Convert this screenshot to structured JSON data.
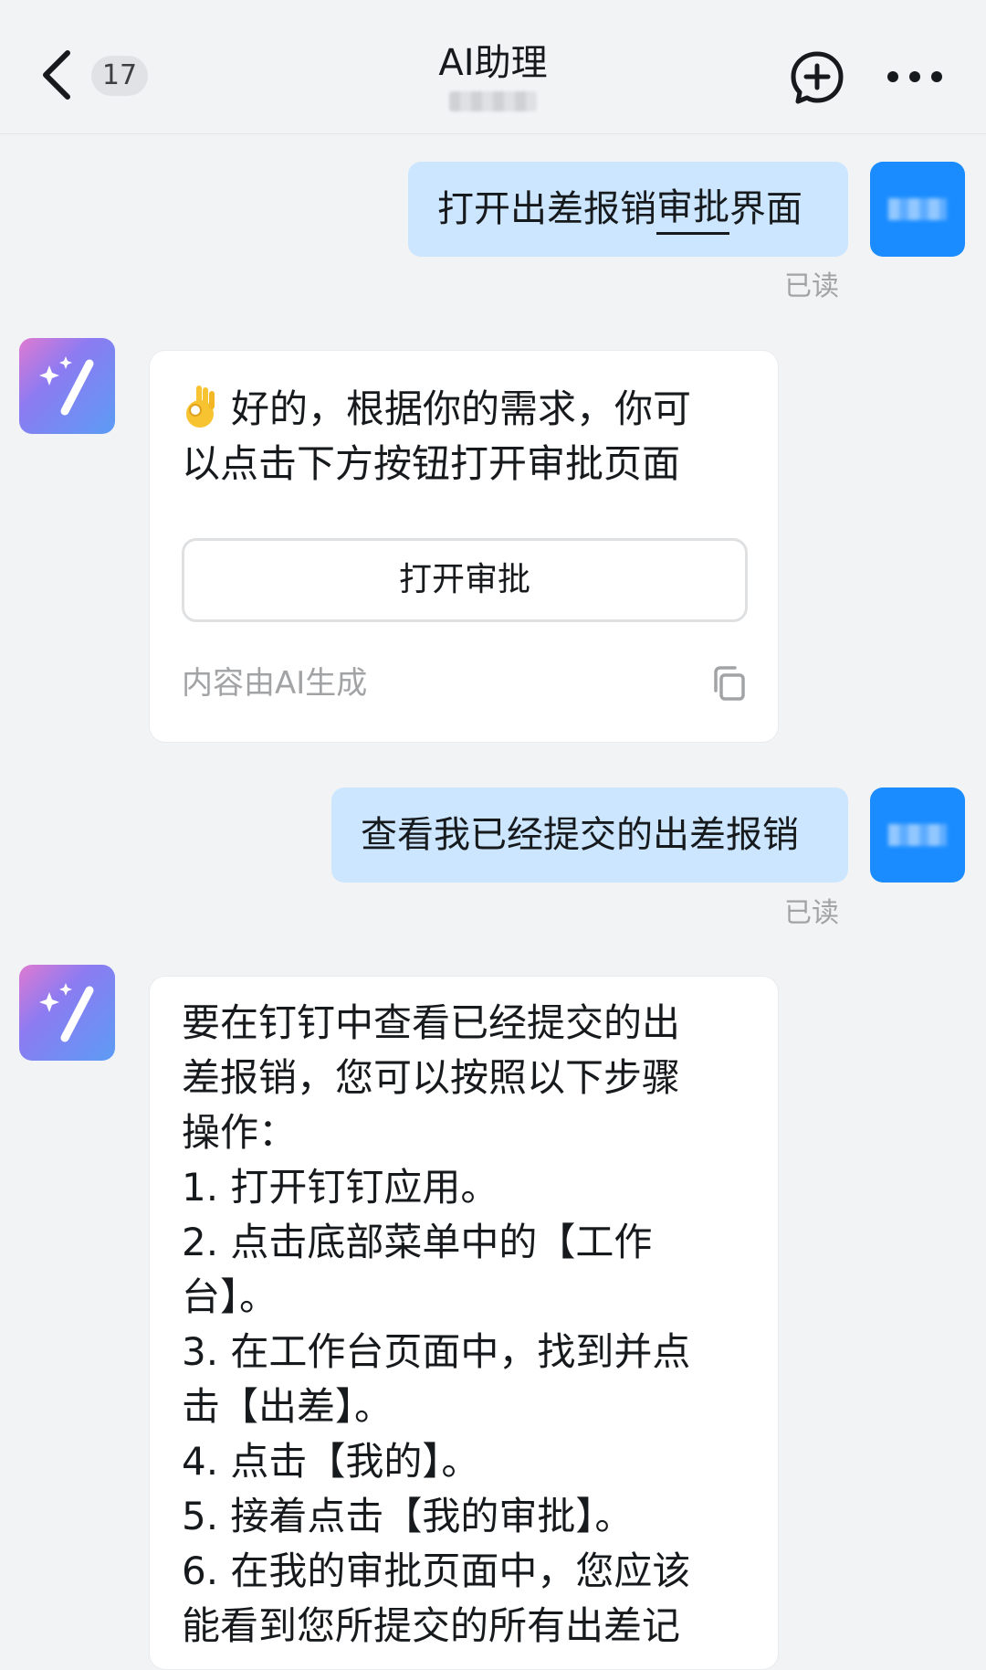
{
  "header": {
    "back_icon": "chevron-left-icon",
    "unread_count": "17",
    "title": "AI助理",
    "add_icon": "plus-circle-icon",
    "more_icon": "ellipsis-icon"
  },
  "messages": [
    {
      "sender": "user",
      "text_before": "打开出差报销",
      "text_underlined": "审批",
      "text_after": "界面",
      "status": "已读"
    },
    {
      "sender": "ai",
      "text": "好的，根据你的需求，你可\n以点击下方按钮打开审批页面",
      "emoji_icon": "ok-hand-icon",
      "button_label": "打开审批",
      "note": "内容由AI生成",
      "copy_icon": "copy-icon"
    },
    {
      "sender": "user",
      "text": "查看我已经提交的出差报销",
      "status": "已读"
    },
    {
      "sender": "ai",
      "intro": "要在钉钉中查看已经提交的出\n差报销，您可以按照以下步骤\n操作：",
      "steps": [
        "1. 打开钉钉应用。",
        "2. 点击底部菜单中的【工作\n台】。",
        "3. 在工作台页面中，找到并点\n击【出差】。",
        "4. 点击【我的】。",
        "5. 接着点击【我的审批】。",
        "6. 在我的审批页面中，您应该\n能看到您所提交的所有出差记"
      ]
    }
  ],
  "colors": {
    "background": "#f2f3f5",
    "user_bubble": "#cce6ff",
    "user_avatar": "#1a8cff",
    "read_text": "#a2a3a5"
  }
}
